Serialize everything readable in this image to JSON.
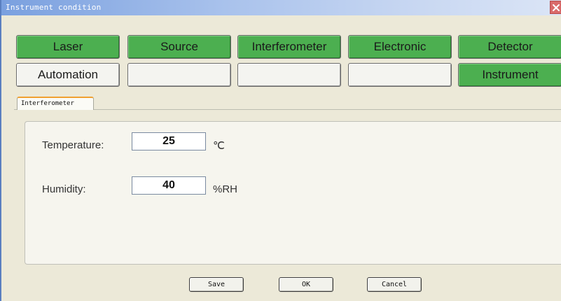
{
  "window": {
    "title": "Instrument condition"
  },
  "tiles": {
    "row1": [
      "Laser",
      "Source",
      "Interferometer",
      "Electronic",
      "Detector"
    ],
    "row2": [
      "Automation",
      "",
      "",
      "",
      "Instrument"
    ]
  },
  "colors": {
    "active_tile": "#4caf50",
    "inactive_tile": "#f4f4f0",
    "tab_accent": "#f0a030"
  },
  "tab": {
    "label": "Interferometer"
  },
  "form": {
    "temperature": {
      "label": "Temperature:",
      "value": "25",
      "unit": "℃"
    },
    "humidity": {
      "label": "Humidity:",
      "value": "40",
      "unit": "%RH"
    }
  },
  "buttons": {
    "save": "Save",
    "ok": "OK",
    "cancel": "Cancel"
  }
}
